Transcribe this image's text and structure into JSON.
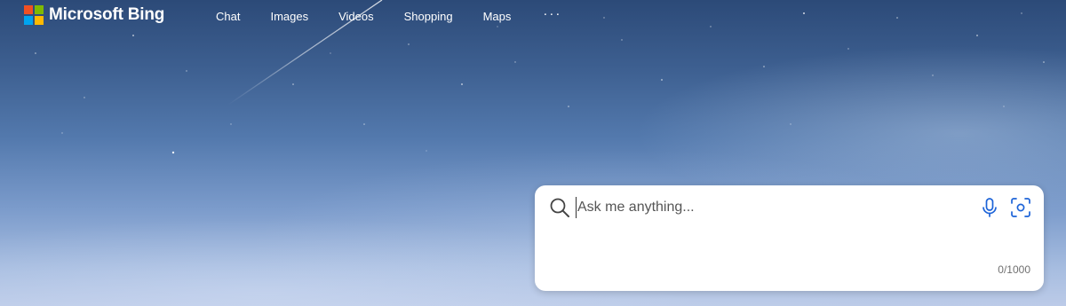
{
  "header": {
    "brand_name": "Microsoft Bing",
    "logo_colors": [
      "#f25022",
      "#7fba00",
      "#00a4ef",
      "#ffb900"
    ],
    "nav": [
      {
        "id": "chat",
        "label": "Chat"
      },
      {
        "id": "images",
        "label": "Images"
      },
      {
        "id": "videos",
        "label": "Videos"
      },
      {
        "id": "shopping",
        "label": "Shopping"
      },
      {
        "id": "maps",
        "label": "Maps"
      }
    ],
    "more_label": "···"
  },
  "search": {
    "placeholder": "Ask me anything...",
    "value": "",
    "char_count": "0/1000",
    "icons": [
      "search-icon",
      "microphone-icon",
      "visual-search-icon"
    ],
    "accent_color": "#1c63d8"
  },
  "background": {
    "description_colors": [
      "#2c4a78",
      "#5379ad",
      "#bccbe8"
    ]
  }
}
